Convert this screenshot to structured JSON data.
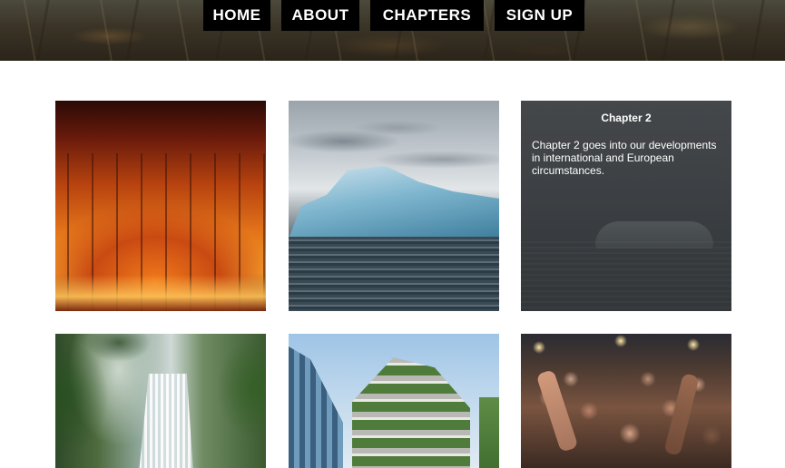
{
  "nav": {
    "home": "HOME",
    "about": "ABOUT",
    "chapters": "CHAPTERS",
    "sign_up": "SIGN UP"
  },
  "tiles": [
    {
      "image": "wildfire-forest"
    },
    {
      "image": "iceberg-sea"
    },
    {
      "image": "flooded-car",
      "title": "Chapter 2",
      "text": "Chapter 2 goes into our developments in international and European circumstances."
    },
    {
      "image": "jungle-waterfall"
    },
    {
      "image": "vertical-forest-building"
    },
    {
      "image": "concert-crowd"
    }
  ]
}
